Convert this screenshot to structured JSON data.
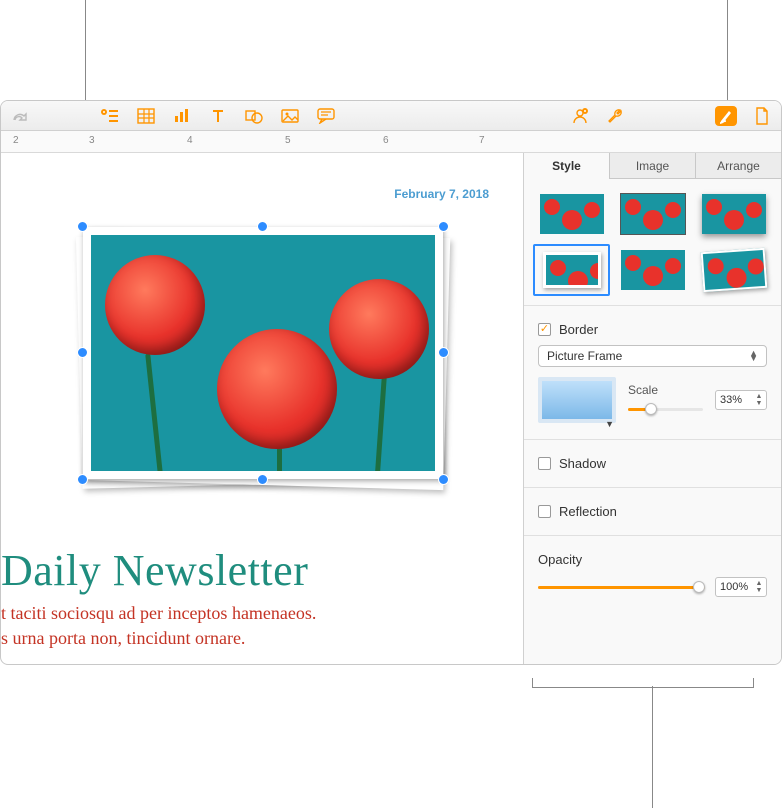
{
  "toolbar": {
    "icons": [
      "redo",
      "insert",
      "table",
      "chart",
      "text",
      "shape",
      "media",
      "comment",
      "collab",
      "tools",
      "format",
      "document"
    ]
  },
  "ruler": {
    "marks": [
      "2",
      "3",
      "4",
      "5",
      "6",
      "7"
    ]
  },
  "document": {
    "date": "February 7, 2018",
    "headline": "Daily Newsletter",
    "body_line1": "t taciti sociosqu ad per inceptos hamenaeos.",
    "body_line2": "s urna porta non, tincidunt ornare."
  },
  "inspector": {
    "tabs": {
      "style": "Style",
      "image": "Image",
      "arrange": "Arrange"
    },
    "border": {
      "label": "Border",
      "checked": true,
      "type": "Picture Frame",
      "scale_label": "Scale",
      "scale_value": "33%",
      "scale_percent": 33
    },
    "shadow": {
      "label": "Shadow",
      "checked": false
    },
    "reflection": {
      "label": "Reflection",
      "checked": false
    },
    "opacity": {
      "label": "Opacity",
      "value": "100%",
      "percent": 100
    }
  }
}
